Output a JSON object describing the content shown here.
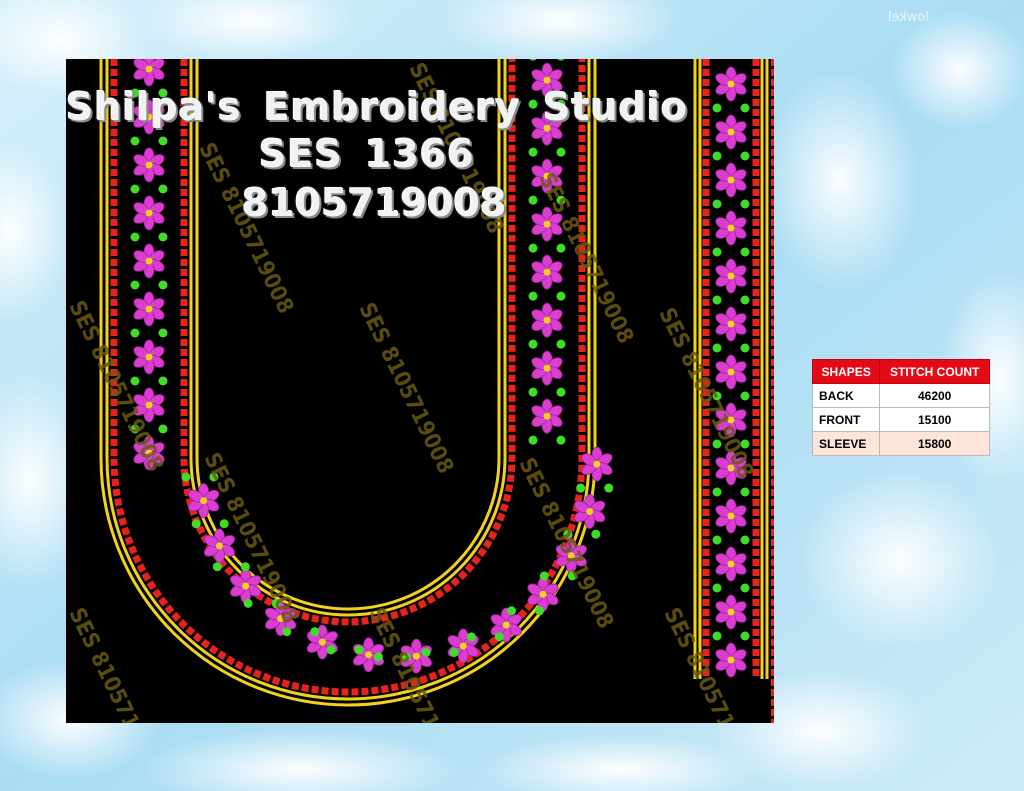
{
  "header": {
    "studio_name": "Shilpa's Embroidery Studio",
    "design_code": "SES 1366",
    "phone": "8105719008"
  },
  "watermark_text": "SES 8105719008",
  "corner_logo": "lowkel",
  "stitch_table": {
    "headers": [
      "SHAPES",
      "STITCH COUNT"
    ],
    "rows": [
      {
        "shape": "BACK",
        "count": "46200"
      },
      {
        "shape": "FRONT",
        "count": "15100"
      },
      {
        "shape": "SLEEVE",
        "count": "15800"
      }
    ]
  },
  "colors": {
    "background": "#bfe6f7",
    "panel": "#000000",
    "gold_border": "#f2d21a",
    "red_dots": "#e8231c",
    "flower": "#d93ed1",
    "green_dots": "#3fdc2a",
    "table_header": "#e30b17"
  }
}
